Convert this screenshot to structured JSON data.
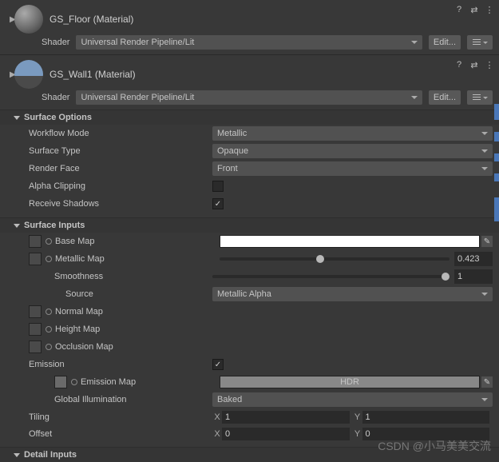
{
  "mat1": {
    "title": "GS_Floor (Material)",
    "shaderLabel": "Shader",
    "shaderValue": "Universal Render Pipeline/Lit",
    "editLabel": "Edit..."
  },
  "mat2": {
    "title": "GS_Wall1 (Material)",
    "shaderLabel": "Shader",
    "shaderValue": "Universal Render Pipeline/Lit",
    "editLabel": "Edit..."
  },
  "sections": {
    "surfaceOptions": "Surface Options",
    "surfaceInputs": "Surface Inputs",
    "detailInputs": "Detail Inputs"
  },
  "opts": {
    "workflowMode": {
      "label": "Workflow Mode",
      "value": "Metallic"
    },
    "surfaceType": {
      "label": "Surface Type",
      "value": "Opaque"
    },
    "renderFace": {
      "label": "Render Face",
      "value": "Front"
    },
    "alphaClipping": {
      "label": "Alpha Clipping"
    },
    "receiveShadows": {
      "label": "Receive Shadows"
    }
  },
  "inputs": {
    "baseMap": "Base Map",
    "metallicMap": "Metallic Map",
    "metallicValue": "0.423",
    "smoothness": "Smoothness",
    "smoothnessValue": "1",
    "source": {
      "label": "Source",
      "value": "Metallic Alpha"
    },
    "normalMap": "Normal Map",
    "heightMap": "Height Map",
    "occlusionMap": "Occlusion Map",
    "emission": "Emission",
    "emissionMap": "Emission Map",
    "hdr": "HDR",
    "globalIllum": {
      "label": "Global Illumination",
      "value": "Baked"
    },
    "tiling": {
      "label": "Tiling",
      "x": "1",
      "y": "1"
    },
    "offset": {
      "label": "Offset",
      "x": "0",
      "y": "0"
    }
  },
  "watermark": "CSDN @小马美美交流"
}
